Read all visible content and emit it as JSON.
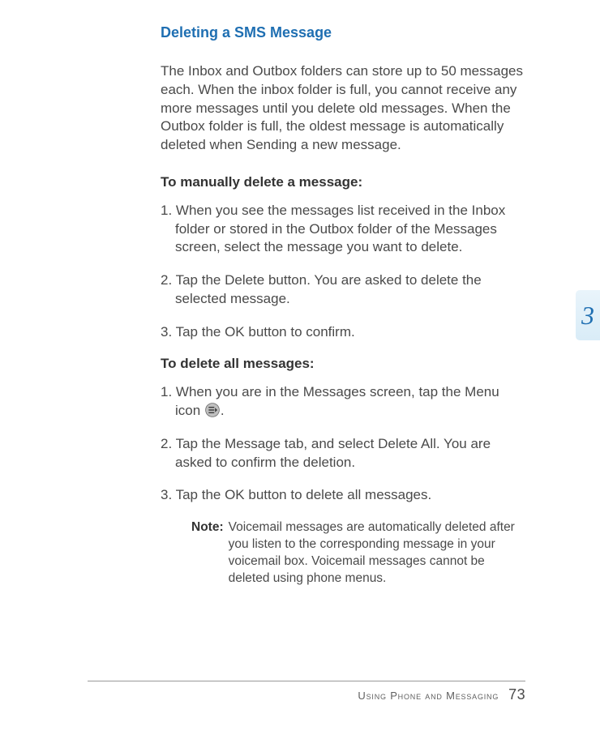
{
  "title": "Deleting a SMS Message",
  "intro": "The Inbox and Outbox folders can store up to 50 messages each. When the inbox folder is full, you cannot receive any more messages until you delete old messages. When the Outbox folder is full, the oldest message is automatically deleted when Sending a new message.",
  "section1": {
    "heading": "To manually delete a message:",
    "steps": [
      "When you see the messages list received in the Inbox folder or stored in the Outbox folder of the Messages screen, select the message you want to delete.",
      "Tap the Delete button. You are asked to delete the selected message.",
      "Tap the OK button to confirm."
    ]
  },
  "section2": {
    "heading": "To delete all messages:",
    "step1_pre": "When you are in the Messages screen, tap the Menu icon ",
    "step1_post": ".",
    "step2": "Tap the Message tab, and select Delete All. You are asked to confirm the deletion.",
    "step3": "Tap the OK button to delete all messages."
  },
  "note": {
    "label": "Note:",
    "text": "Voicemail messages are automatically deleted after you listen to the corresponding message in your voicemail box. Voicemail messages cannot be deleted using phone menus."
  },
  "side_tab": "3",
  "footer": {
    "section": "Using Phone and Messaging",
    "page": "73"
  }
}
